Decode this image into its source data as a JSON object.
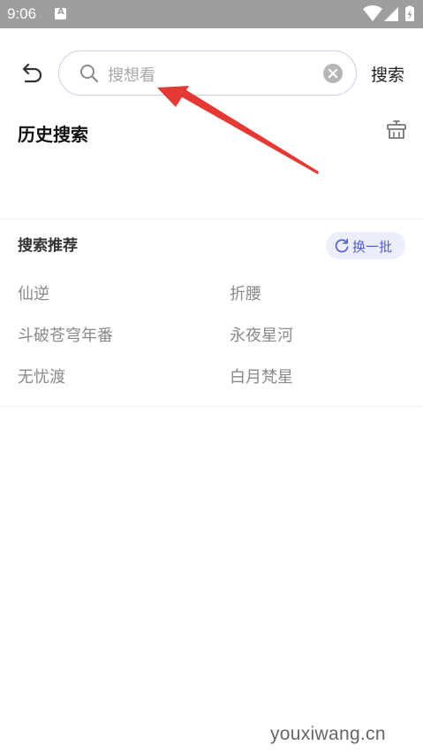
{
  "status_bar": {
    "time": "9:06",
    "icons": [
      "notification-a-icon",
      "wifi-icon",
      "signal-icon",
      "battery-charging-icon"
    ]
  },
  "search": {
    "placeholder": "搜想看",
    "submit_label": "搜索",
    "icons": [
      "back-icon",
      "search-icon",
      "clear-icon"
    ]
  },
  "history": {
    "title": "历史搜索",
    "clear_icon": "trash-icon",
    "items": []
  },
  "recommend": {
    "title": "搜索推荐",
    "refresh_label": "换一批",
    "items": [
      "仙逆",
      "折腰",
      "斗破苍穹年番",
      "永夜星河",
      "无忧渡",
      "白月梵星"
    ]
  },
  "colors": {
    "status_bar": "#9e9e9e",
    "accent": "#5560c8",
    "accent_bg": "#eceefb",
    "search_border": "#c9cdea",
    "annotation_arrow": "#e53935"
  },
  "watermark": "youxiwang.cn"
}
